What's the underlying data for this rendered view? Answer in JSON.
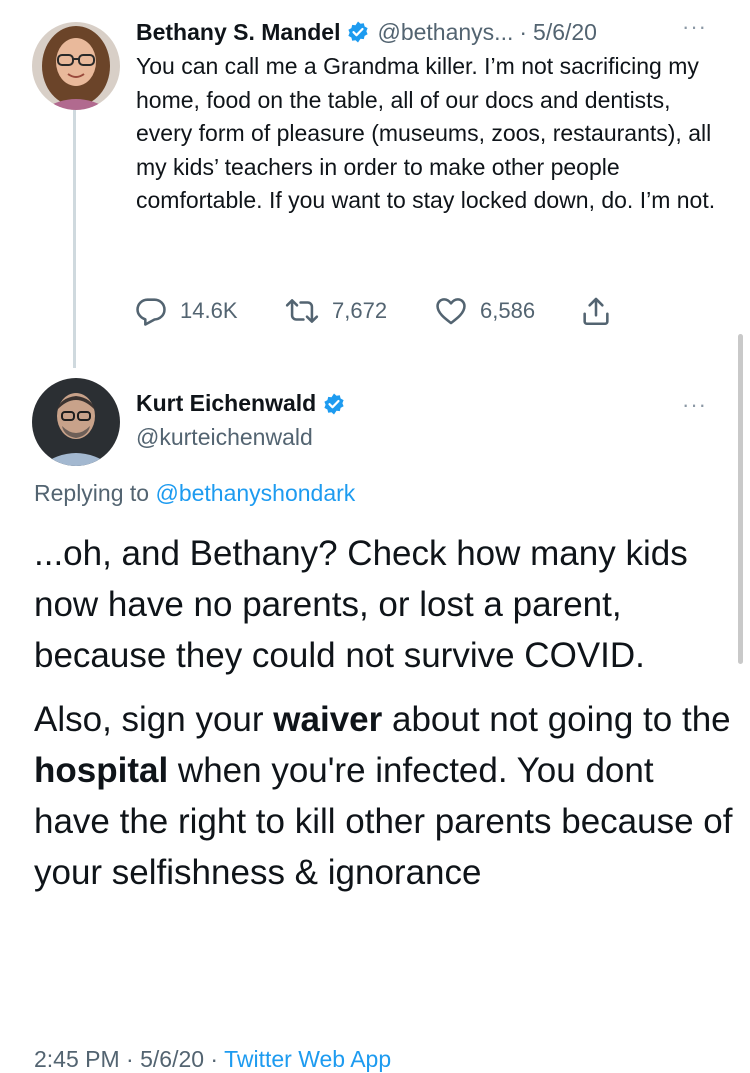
{
  "parent_tweet": {
    "author_name": "Bethany S. Mandel",
    "handle": "@bethanys...",
    "date": "5/6/20",
    "separator": "·",
    "text": "You can call me a Grandma killer. I’m not sacrificing my home, food on the table, all of our docs and dentists, every form of pleasure (museums, zoos, restaurants), all my kids’ teachers in order to make other people comfortable. If you want to stay locked down, do. I’m not.",
    "replies": "14.6K",
    "retweets": "7,672",
    "likes": "6,586",
    "more_icon": "···"
  },
  "reply_tweet": {
    "author_name": "Kurt Eichenwald",
    "handle": "@kurteichenwald",
    "replying_prefix": "Replying to",
    "replying_to": "@bethanyshondark",
    "para1": "...oh, and Bethany? Check how many kids now have no parents, or lost a parent, because they could not survive COVID.",
    "para2_part1": "Also, sign your",
    "para2_bold1": "waiver",
    "para2_part2": "about not going to the",
    "para2_bold2": "hospital",
    "para2_part3": "when you're infected. You dont have the right to kill other parents because of your selfishness & ignorance",
    "time": "2:45 PM · 5/6/20 ·",
    "source": "Twitter Web App",
    "more_icon": "···"
  },
  "colors": {
    "verified": "#1d9bf0",
    "secondary_text": "#536471",
    "link": "#1d9bf0",
    "thread_line": "#cfd9de"
  },
  "icons": [
    "reply-icon",
    "retweet-icon",
    "like-icon",
    "share-icon",
    "verified-badge-icon",
    "more-icon"
  ]
}
